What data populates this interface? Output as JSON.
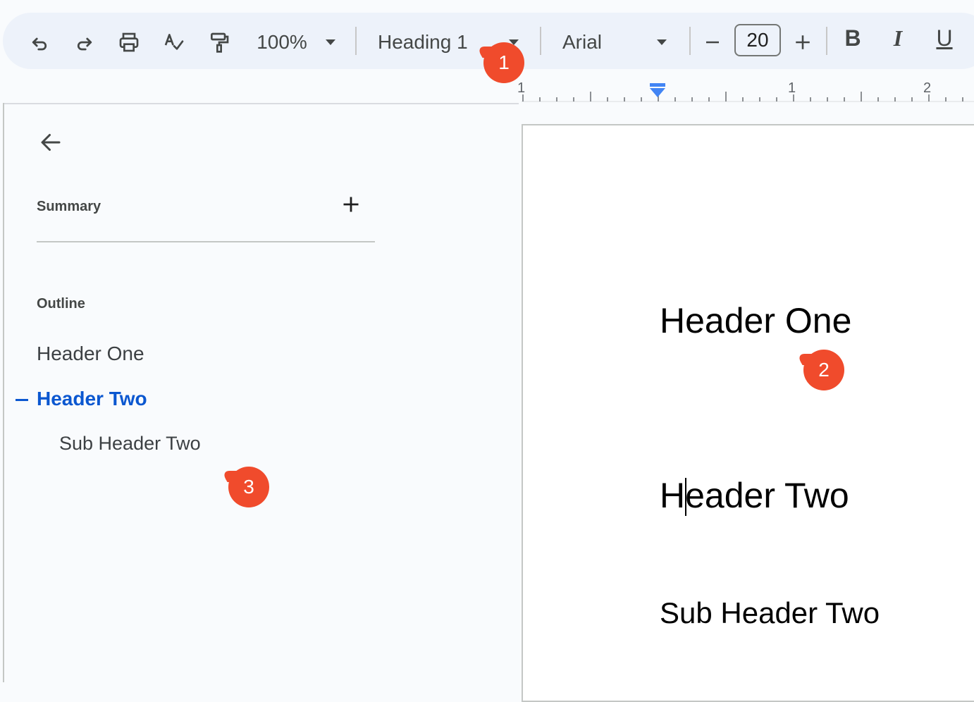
{
  "toolbar": {
    "zoom": "100%",
    "style": "Heading 1",
    "font": "Arial",
    "font_size": "20",
    "bold": "B",
    "italic": "I",
    "underline": "U"
  },
  "ruler": {
    "labels": [
      "1",
      "1",
      "2"
    ]
  },
  "sidebar": {
    "summary_label": "Summary",
    "outline_label": "Outline",
    "outline_items": [
      {
        "label": "Header One",
        "level": 1,
        "active": false
      },
      {
        "label": "Header Two",
        "level": 1,
        "active": true
      },
      {
        "label": "Sub Header Two",
        "level": 2,
        "active": false
      }
    ]
  },
  "document": {
    "heading_one": "Header One",
    "heading_two": "Header Two",
    "sub_heading_two": "Sub Header Two"
  },
  "badges": [
    "1",
    "2",
    "3"
  ],
  "colors": {
    "accent": "#0b57d0",
    "badge": "#f04b2c",
    "toolbar_bg": "#edf2fa"
  }
}
